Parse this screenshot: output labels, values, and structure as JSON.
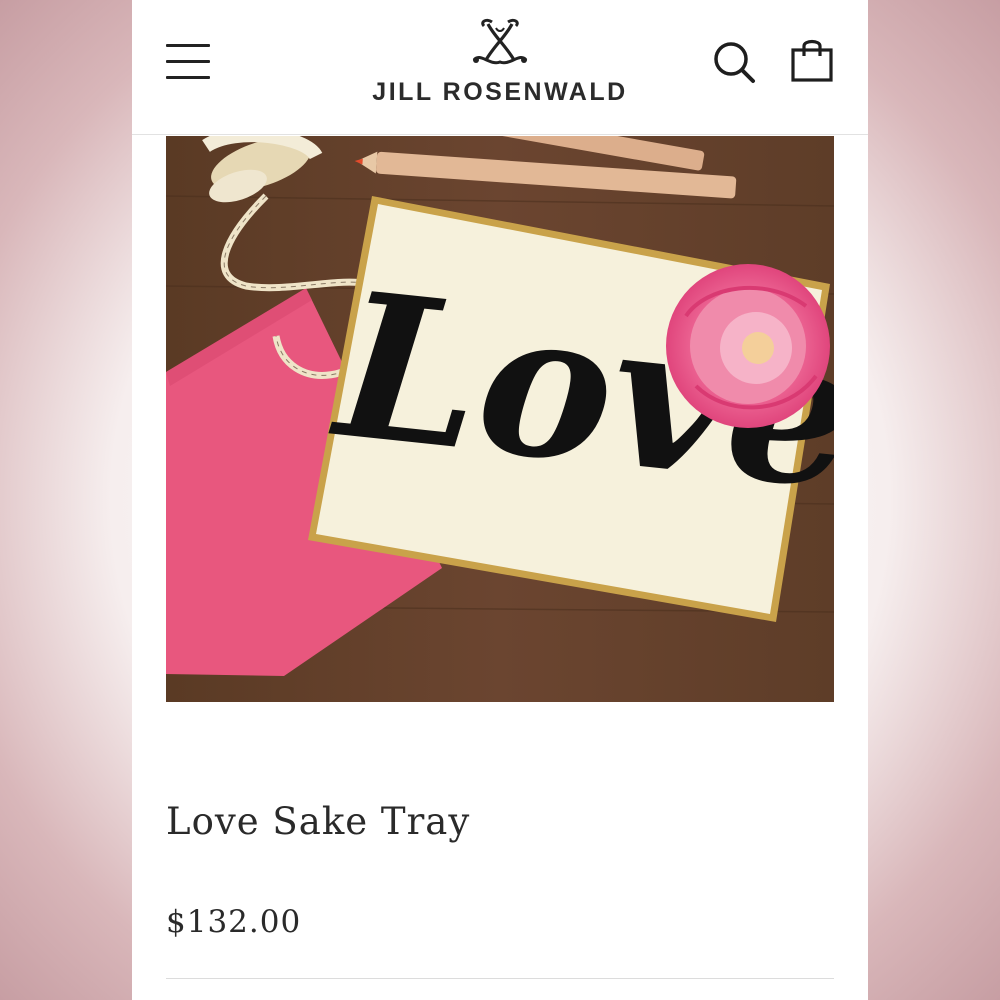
{
  "header": {
    "menu_icon": "hamburger-menu-icon",
    "brand_name": "JILL ROSENWALD",
    "logo_icon": "jr-monogram-logo",
    "search_icon": "search-icon",
    "cart_icon": "shopping-bag-icon"
  },
  "product": {
    "image_lettering": "Love",
    "title": "Love Sake Tray",
    "price": "$132.00"
  },
  "colors": {
    "text": "#2a2a2a",
    "tray_gold_rim": "#c9a24a",
    "accent_pink": "#e8577e"
  }
}
